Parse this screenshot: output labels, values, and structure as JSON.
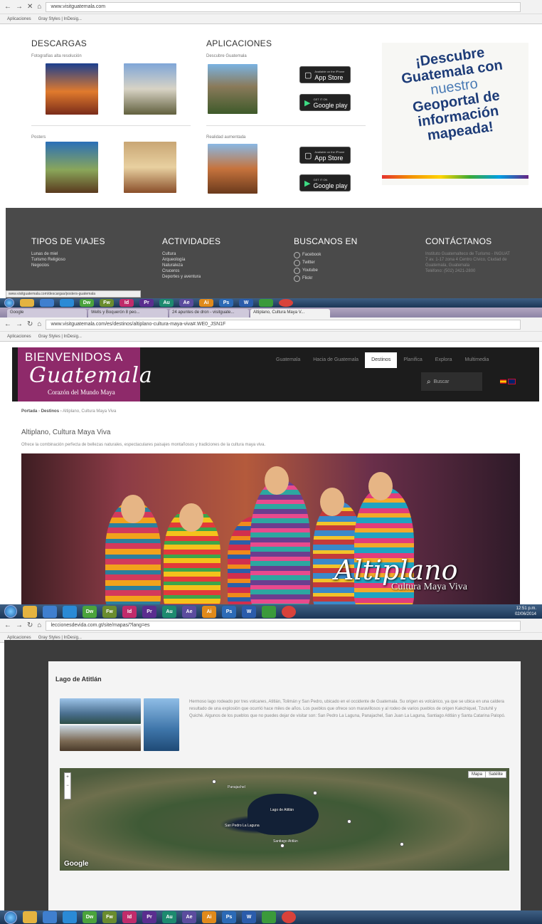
{
  "shot1": {
    "url": "www.visitguatemala.com",
    "bookmarks": [
      "Aplicaciones",
      "Gray Styles | InDesig..."
    ],
    "descargas": {
      "heading": "DESCARGAS",
      "photos_label": "Fotografías alta resolución",
      "posters_label": "Posters"
    },
    "aplicaciones": {
      "heading": "APLICACIONES",
      "discover_label": "Descubre Guatemala",
      "ar_label": "Realidad aumentada",
      "appstore_small": "Available on the iPhone",
      "appstore": "App Store",
      "googleplay_small": "GET IT ON",
      "googleplay": "Google play"
    },
    "promo": {
      "line1": "¡Descubre",
      "line2": "Guatemala con",
      "line3": "nuestro",
      "line4": "Geoportal de",
      "line5": "información",
      "line6": "mapeada!"
    },
    "footer": {
      "tipos": {
        "heading": "TIPOS DE VIAJES",
        "items": [
          "Lunas de miel",
          "Turismo Religioso",
          "Negocios"
        ]
      },
      "actividades": {
        "heading": "ACTIVIDADES",
        "items": [
          "Cultura",
          "Arqueología",
          "Naturaleza",
          "Cruceros",
          "Deportes y aventura"
        ]
      },
      "buscanos": {
        "heading": "BUSCANOS EN",
        "items": [
          "Facebook",
          "Twitter",
          "Youtube",
          "Flickr"
        ]
      },
      "contacto": {
        "heading": "CONTÁCTANOS",
        "items": [
          "Instituto Guatemalteco de Turismo - INGUAT",
          "7 av. 1-17 zona 4 Centro Cívico, Ciudad de",
          "Guatemala, Guatemala",
          "Teléfono: (502) 2421-2800"
        ]
      }
    },
    "status_url": "www.visitguatemala.com/descargas/posters-guatemala"
  },
  "shot2": {
    "tabs": [
      "Google",
      "Wells y Boquerón 8 peo...",
      "24 apuntes de dron - visitguate...",
      "Altiplano, Cultura Maya V..."
    ],
    "url": "www.visitguatemala.com/es/destinos/altiplano-cultura-maya-viva#.WE0_JSN1F",
    "bookmarks": [
      "Aplicaciones",
      "Gray Styles | InDesig..."
    ],
    "logo": {
      "welcome": "BIENVENIDOS A",
      "name": "Guatemala",
      "tagline": "Corazón del Mundo Maya"
    },
    "menu": [
      "Guatemala",
      "Hacia de Guatemala",
      "Destinos",
      "Planifica",
      "Explora",
      "Multimedia"
    ],
    "active_menu": "Destinos",
    "search_placeholder": "Buscar",
    "breadcrumb": {
      "home": "Portada",
      "section": "Destinos",
      "current": "Altiplano, Cultura Maya Viva"
    },
    "page_title": "Altiplano, Cultura Maya Viva",
    "page_desc": "Ofrece la combinación perfecta de bellezas naturales, espectaculares paisajes montañosos y tradiciones de la cultura maya viva.",
    "hero_title": "Altiplano",
    "hero_sub": "Cultura Maya Viva",
    "tray_time": "12:51 p.m.",
    "tray_date": "02/06/2014"
  },
  "shot3": {
    "url": "leccionesdevida.com.gt/site/mapas/?lang=es",
    "bookmarks": [
      "Aplicaciones",
      "Gray Styles | InDesig..."
    ],
    "card_title": "Lago de Atitlán",
    "description": "Hermoso lago rodeado por tres volcanes, Atitlán, Tolimán y San Pedro, ubicado en el occidente de Guatemala. Su origen es volcánico, ya que se ubica en una caldera resultado de una explosión que ocurrió hace miles de años. Los pueblos que ofrece son maravillosos y al rodeo de varios pueblos de origen Kakchiquel, Tzutuhil y Quiché. Algunos de los pueblos que no puedes dejar de visitar son: San Pedro La Laguna, Panajachel, San Juan La Laguna, Santiago Atitlán y Santa Catarina Palopó.",
    "map_controls": [
      "Mapa",
      "Satélite"
    ],
    "map_labels": [
      "Panajachel",
      "Lago de Atitlán",
      "San Pedro La Laguna",
      "Santiago Atitlán"
    ],
    "map_brand": "Google"
  },
  "colors": {
    "footer": "#4a4a4a",
    "logo": "#8e2a6a",
    "header": "#1c1c1c",
    "taskbar": "#1c3656"
  }
}
